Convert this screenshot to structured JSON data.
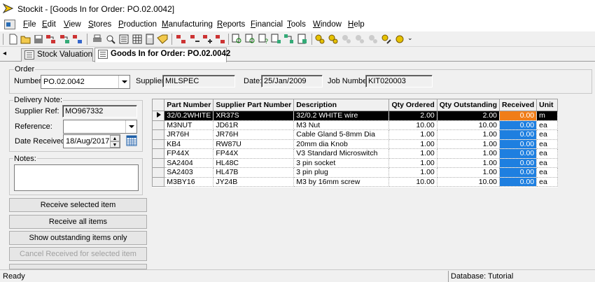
{
  "window": {
    "title": "Stockit - [Goods In for Order: PO.02.0042]"
  },
  "menu": [
    "File",
    "Edit",
    "View",
    "Stores",
    "Production",
    "Manufacturing",
    "Reports",
    "Financial",
    "Tools",
    "Window",
    "Help"
  ],
  "toolbar": {
    "buttons": [
      "new-icon",
      "open-icon",
      "save-icon",
      "transfer-icon",
      "stock-icon",
      "print-icon",
      "preview-icon",
      "list-icon",
      "calculator-icon",
      "tag-icon",
      "move-icon",
      "transfer-in-icon",
      "transfer-out-icon",
      "report-icon",
      "search-icon",
      "search-doc-icon",
      "query-icon",
      "search-item-icon",
      "network-icon",
      "document-icon",
      "group-icon",
      "group-add-icon",
      "group-dis-icon",
      "group-dis2-icon",
      "group-dis3-icon",
      "coin-icon"
    ]
  },
  "tabs": [
    {
      "label": "Stock Valuation",
      "active": false
    },
    {
      "label": "Goods In for Order: PO.02.0042",
      "active": true
    }
  ],
  "order": {
    "group_label": "Order",
    "number_label": "Number:",
    "number_value": "PO.02.0042",
    "supplier_label": "Supplier:",
    "supplier_value": "MILSPEC",
    "date_label": "Date:",
    "date_value": "25/Jan/2009",
    "job_label": "Job Number:",
    "job_value": "KIT020003"
  },
  "delivery": {
    "group_label": "Delivery Note:",
    "supplier_ref_label": "Supplier Ref:",
    "supplier_ref_value": "MO967332",
    "reference_label": "Reference:",
    "reference_value": "",
    "date_received_label": "Date Received:",
    "date_received_value": "18/Aug/2017"
  },
  "notes": {
    "label": "Notes:",
    "value": ""
  },
  "buttons": {
    "receive_selected": "Receive selected item",
    "receive_all": "Receive all items",
    "show_outstanding": "Show outstanding items only",
    "cancel_received": "Cancel Received for selected item"
  },
  "grid": {
    "columns": [
      "Part Number",
      "Supplier Part Number",
      "Description",
      "Qty Ordered",
      "Qty Outstanding",
      "Received",
      "Unit"
    ],
    "rows": [
      [
        "32/0.2WHITE",
        "XR37S",
        "32/0.2 WHITE wire",
        "2.00",
        "2.00",
        "0.00",
        "m"
      ],
      [
        "M3NUT",
        "JD61R",
        "M3 Nut",
        "10.00",
        "10.00",
        "0.00",
        "ea"
      ],
      [
        "JR76H",
        "JR76H",
        "Cable Gland 5-8mm Dia",
        "1.00",
        "1.00",
        "0.00",
        "ea"
      ],
      [
        "KB4",
        "RW87U",
        "20mm dia Knob",
        "1.00",
        "1.00",
        "0.00",
        "ea"
      ],
      [
        "FP44X",
        "FP44X",
        "V3 Standard Microswitch",
        "1.00",
        "1.00",
        "0.00",
        "ea"
      ],
      [
        "SA2404",
        "HL48C",
        "3 pin socket",
        "1.00",
        "1.00",
        "0.00",
        "ea"
      ],
      [
        "SA2403",
        "HL47B",
        "3 pin plug",
        "1.00",
        "1.00",
        "0.00",
        "ea"
      ],
      [
        "M3BY16",
        "JY24B",
        "M3 by 16mm screw",
        "10.00",
        "10.00",
        "0.00",
        "ea"
      ]
    ],
    "selected_row": 0
  },
  "status": {
    "left": "Ready",
    "database": "Database: Tutorial"
  },
  "colors": {
    "received_cell": "#1e7fe0",
    "received_selected": "#f07d18",
    "selected_row": "#000000"
  }
}
